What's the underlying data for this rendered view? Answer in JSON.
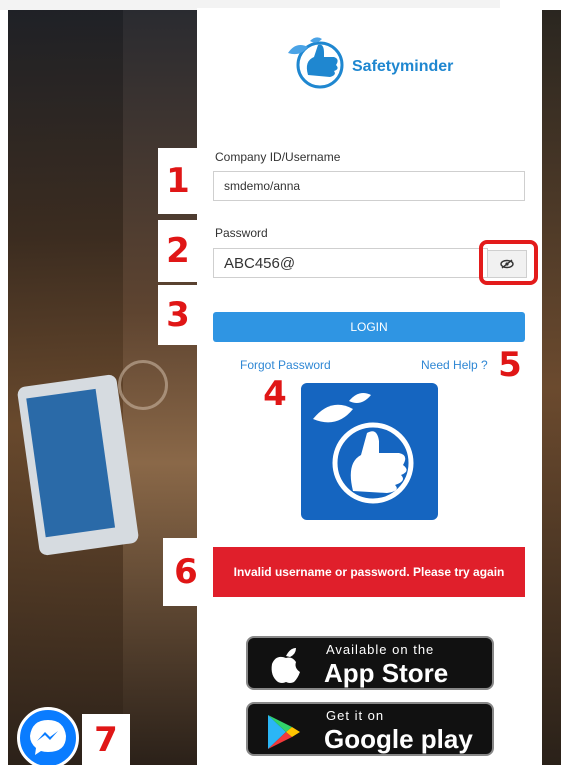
{
  "brand": {
    "name": "Safetyminder"
  },
  "form": {
    "username_label": "Company ID/Username",
    "username_value": "smdemo/anna",
    "password_label": "Password",
    "password_value": "ABC456@",
    "login_label": "LOGIN",
    "forgot_label": "Forgot Password",
    "help_label": "Need Help ?"
  },
  "error": {
    "message": "Invalid username or password. Please try again"
  },
  "stores": {
    "apple_small": "Available on the",
    "apple_big": "App Store",
    "google_small": "Get it on",
    "google_big": "Google play"
  },
  "markers": [
    "1",
    "2",
    "3",
    "4",
    "5",
    "6",
    "7"
  ],
  "colors": {
    "accent": "#2f95e3",
    "brand": "#1565c0",
    "error": "#e01f2b",
    "marker": "#e01616"
  },
  "icons": {
    "eye": "eye-slash-icon",
    "messenger": "messenger-icon",
    "apple": "apple-icon",
    "play": "google-play-icon"
  }
}
